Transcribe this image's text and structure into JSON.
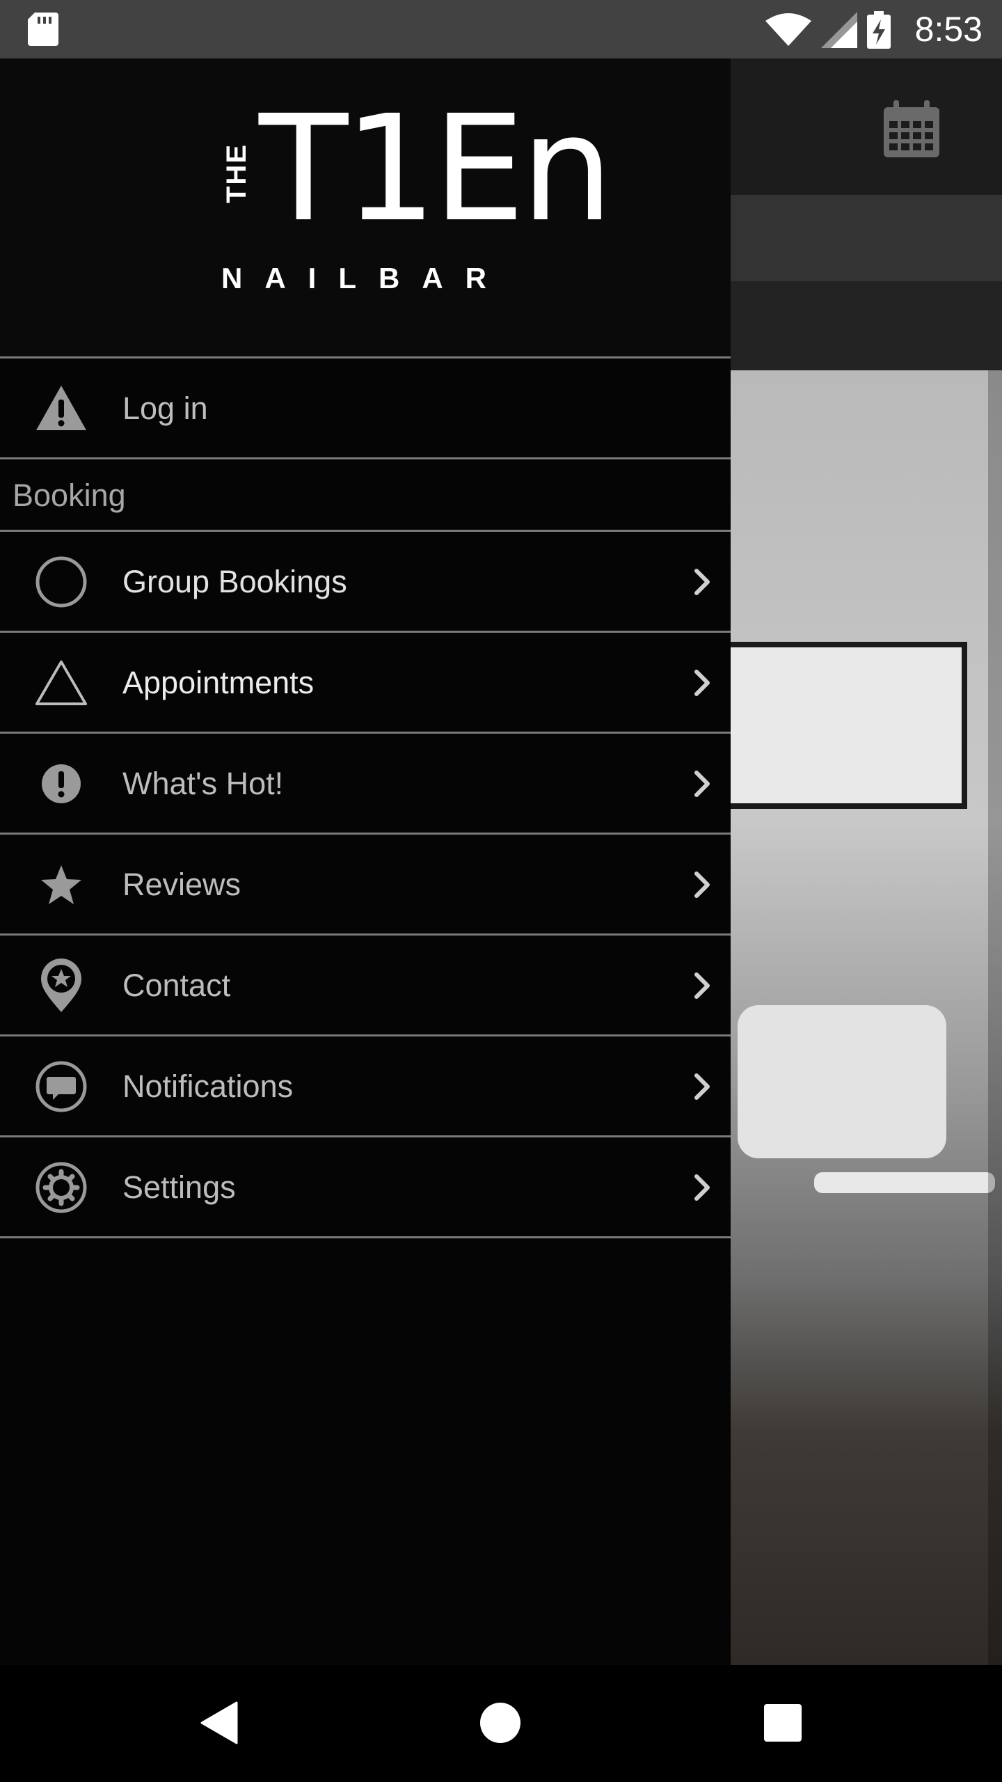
{
  "status_bar": {
    "time": "8:53",
    "icons": [
      "sd-card-icon",
      "wifi-icon",
      "signal-icon",
      "battery-charging-icon"
    ]
  },
  "background_app": {
    "toolbar_icon": "calendar-icon"
  },
  "drawer": {
    "logo": {
      "the": "THE",
      "ten": "T1En",
      "sub": "NAILBAR"
    },
    "login": {
      "label": "Log in",
      "icon": "warning-icon"
    },
    "section": {
      "label": "Booking"
    },
    "items": [
      {
        "label": "Group Bookings",
        "icon": "circle-icon"
      },
      {
        "label": "Appointments",
        "icon": "triangle-icon"
      },
      {
        "label": "What's Hot!",
        "icon": "exclamation-icon"
      },
      {
        "label": "Reviews",
        "icon": "star-icon"
      },
      {
        "label": "Contact",
        "icon": "map-pin-star-icon"
      },
      {
        "label": "Notifications",
        "icon": "chat-bubble-icon"
      },
      {
        "label": "Settings",
        "icon": "gear-icon"
      }
    ]
  },
  "nav_bar": {
    "buttons": [
      "back-icon",
      "home-icon",
      "recents-icon"
    ]
  }
}
